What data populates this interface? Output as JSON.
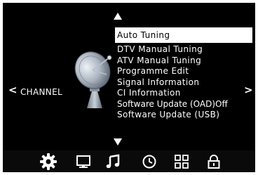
{
  "menu": {
    "category": "CHANNEL",
    "prev_symbol": "<",
    "next_symbol": ">",
    "items": [
      {
        "label": "Auto Tuning",
        "selected": true
      },
      {
        "label": "DTV Manual Tuning",
        "selected": false
      },
      {
        "label": "ATV Manual Tuning",
        "selected": false
      },
      {
        "label": "Programme Edit",
        "selected": false
      },
      {
        "label": "Signal Information",
        "selected": false
      },
      {
        "label": "CI Information",
        "selected": false
      },
      {
        "label": "Software Update (OAD)Off",
        "selected": false
      },
      {
        "label": "Software Update (USB)",
        "selected": false
      }
    ]
  },
  "bottom_bar": {
    "icons": [
      {
        "name": "settings-gear-icon",
        "active": true
      },
      {
        "name": "picture-monitor-icon",
        "active": false
      },
      {
        "name": "sound-music-icon",
        "active": false
      },
      {
        "name": "time-clock-icon",
        "active": false
      },
      {
        "name": "options-grid-icon",
        "active": false
      },
      {
        "name": "lock-icon",
        "active": false
      }
    ]
  },
  "colors": {
    "background": "#000000",
    "text": "#ffffff",
    "selected_bg": "#ffffff",
    "selected_text": "#000000"
  }
}
